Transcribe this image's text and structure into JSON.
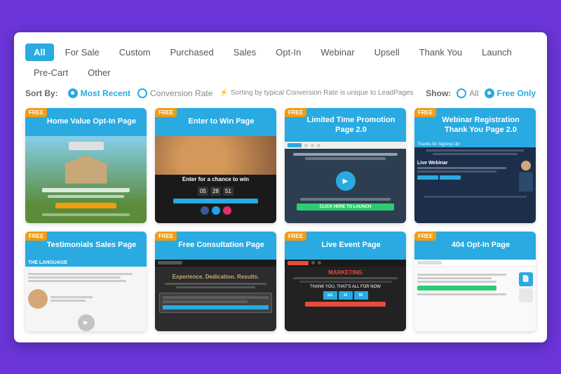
{
  "tabs": [
    {
      "label": "All",
      "active": true
    },
    {
      "label": "For Sale",
      "active": false
    },
    {
      "label": "Custom",
      "active": false
    },
    {
      "label": "Purchased",
      "active": false
    },
    {
      "label": "Sales",
      "active": false
    },
    {
      "label": "Opt-In",
      "active": false
    },
    {
      "label": "Webinar",
      "active": false
    },
    {
      "label": "Upsell",
      "active": false
    },
    {
      "label": "Thank You",
      "active": false
    },
    {
      "label": "Launch",
      "active": false
    },
    {
      "label": "Pre-Cart",
      "active": false
    },
    {
      "label": "Other",
      "active": false
    }
  ],
  "controls": {
    "sort_label": "Sort By:",
    "sort_options": [
      {
        "label": "Most Recent",
        "selected": true
      },
      {
        "label": "Conversion Rate",
        "selected": false
      }
    ],
    "conversion_note": "Sorting by typical Conversion Rate is unique to LeadPages",
    "show_label": "Show:",
    "show_options": [
      {
        "label": "All",
        "selected": false
      },
      {
        "label": "Free Only",
        "selected": true
      }
    ]
  },
  "cards": [
    {
      "title": "Home Value Opt-In Page",
      "free": true,
      "preview_type": "home-value"
    },
    {
      "title": "Enter to Win Page",
      "free": true,
      "preview_type": "enter-win"
    },
    {
      "title": "Limited Time Promotion Page 2.0",
      "free": true,
      "preview_type": "limited-time"
    },
    {
      "title": "Webinar Registration Thank You Page 2.0",
      "free": true,
      "preview_type": "webinar"
    },
    {
      "title": "Testimonials Sales Page",
      "free": true,
      "preview_type": "testimonials"
    },
    {
      "title": "Free Consultation Page",
      "free": true,
      "preview_type": "consultation"
    },
    {
      "title": "Live Event Page",
      "free": true,
      "preview_type": "live-event"
    },
    {
      "title": "404 Opt-In Page",
      "free": true,
      "preview_type": "404"
    }
  ],
  "badge_text": "FREE",
  "colors": {
    "accent": "#29aae1",
    "badge": "#f39c12",
    "green": "#2ecc71",
    "dark": "#1a1a1a"
  }
}
